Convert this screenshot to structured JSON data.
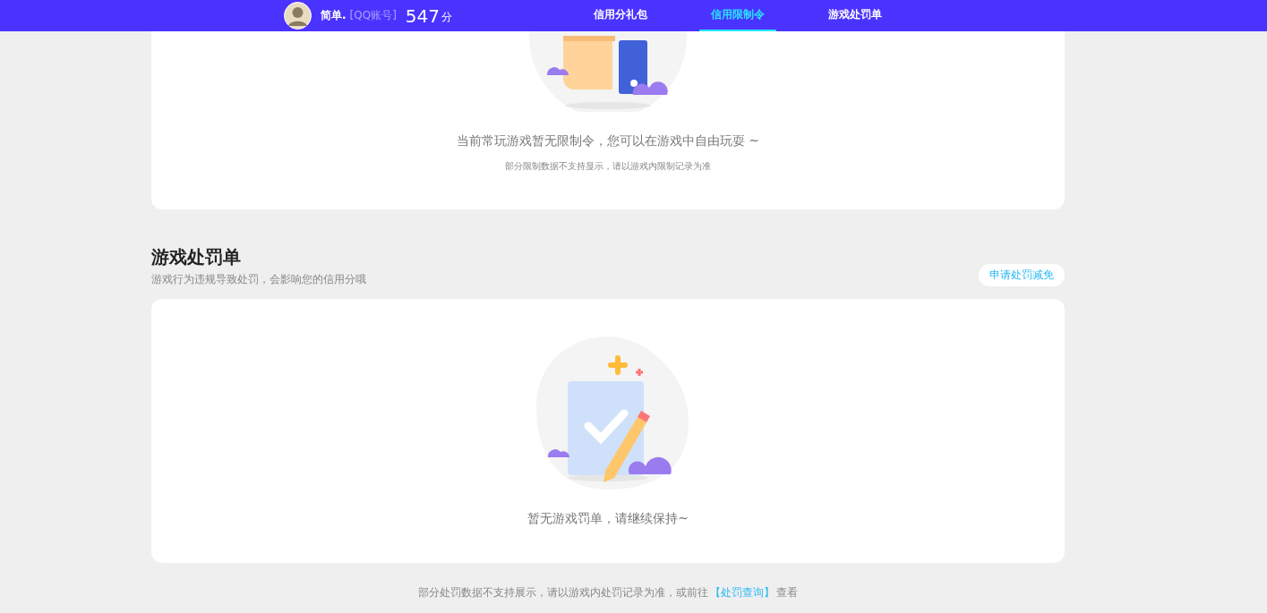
{
  "header": {
    "user_name": "简单.",
    "account_type": "[QQ账号]",
    "score": "547",
    "score_unit": "分",
    "tabs": [
      {
        "label": "信用分礼包",
        "selected": false
      },
      {
        "label": "信用限制令",
        "selected": true
      },
      {
        "label": "游戏处罚单",
        "selected": false
      }
    ]
  },
  "restriction_card": {
    "message": "当前常玩游戏暂无限制令，您可以在游戏中自由玩耍 ~",
    "note": "部分限制数据不支持显示，请以游戏内限制记录为准"
  },
  "penalty_section": {
    "title": "游戏处罚单",
    "subtitle": "游戏行为违规导致处罚，会影响您的信用分哦",
    "appeal_button": "申请处罚减免",
    "empty_message": "暂无游戏罚单，请继续保持~"
  },
  "footer": {
    "text": "部分处罚数据不支持展示，请以游戏内处罚记录为准，或前往",
    "link": "【处罚查询】",
    "suffix": "查看"
  }
}
